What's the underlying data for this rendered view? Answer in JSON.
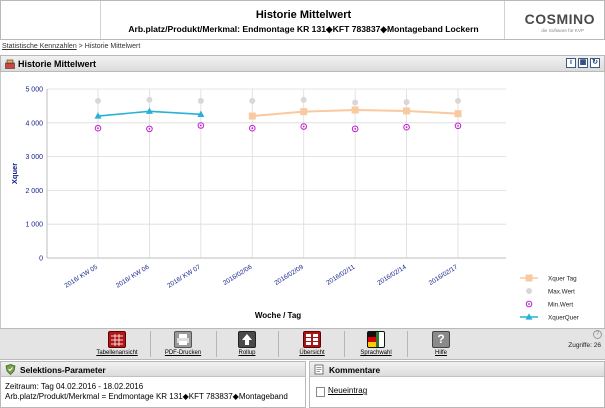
{
  "header": {
    "title": "Historie Mittelwert",
    "subtitle": "Arb.platz/Produkt/Merkmal: Endmontage KR 131◆KFT 783837◆Montageband Lockern",
    "logo_text": "COSMINO",
    "logo_tagline": "die Software für KVP"
  },
  "breadcrumb": {
    "link": "Statistische Kennzahlen",
    "separator": " > ",
    "current": "Historie Mittelwert"
  },
  "panel": {
    "title": "Historie Mittelwert",
    "tools": [
      "i",
      "▦",
      "↻"
    ]
  },
  "colors": {
    "xquer_tag": "#f9c9a0",
    "max_wert": "#d8d8d8",
    "min_wert": "#c21fcf",
    "xquer_quer": "#29b2d6",
    "grid": "#dcdcdc",
    "axis_text": "#0f1c8a"
  },
  "chart_data": {
    "type": "line",
    "ylabel": "Xquer",
    "xlabel": "Woche / Tag",
    "ylim": [
      0,
      5000
    ],
    "yticks": [
      0,
      1000,
      2000,
      3000,
      4000,
      5000
    ],
    "ytick_labels": [
      "0",
      "1 000",
      "2 000",
      "3 000",
      "4 000",
      "5 000"
    ],
    "categories": [
      "2016/ KW 05",
      "2016/ KW 06",
      "2016/ KW 07",
      "2016/02/06",
      "2016/02/09",
      "2016/02/11",
      "2016/02/14",
      "2016/02/17"
    ],
    "grid": true,
    "legend_position": "right",
    "series": [
      {
        "name": "Xquer Tag",
        "marker": "square",
        "values": [
          null,
          null,
          null,
          4200,
          4330,
          4380,
          4350,
          4270
        ]
      },
      {
        "name": "Max.Wert",
        "marker": "circle",
        "values": [
          4650,
          4680,
          4650,
          4650,
          4680,
          4600,
          4610,
          4650
        ]
      },
      {
        "name": "Min.Wert",
        "marker": "ring",
        "values": [
          3840,
          3820,
          3920,
          3840,
          3890,
          3820,
          3870,
          3910
        ]
      },
      {
        "name": "XquerQuer",
        "marker": "triangle",
        "values": [
          4200,
          4340,
          4250,
          null,
          null,
          null,
          null,
          null
        ]
      }
    ]
  },
  "toolbar": {
    "buttons": [
      {
        "label": "Tabellenansicht",
        "icon": "table-icon",
        "color": "#b01818"
      },
      {
        "label": "PDF-Drucken",
        "icon": "printer-icon",
        "color": "#8a8a8a"
      },
      {
        "label": "Rollup",
        "icon": "rollup-arrow-icon",
        "color": "#444444"
      },
      {
        "label": "Übersicht",
        "icon": "overview-grid-icon",
        "color": "#a01818"
      },
      {
        "label": "Sprachwahl",
        "icon": "flag-icon",
        "color": "#2d7a2d"
      },
      {
        "label": "Hilfe",
        "icon": "help-icon",
        "color": "#7a7a7a"
      }
    ],
    "zugriffe": "Zugriffe: 26",
    "help_circle": "?"
  },
  "selection": {
    "title": "Selektions-Parameter",
    "zeitraum": "Zeitraum: Tag 04.02.2016 - 18.02.2016",
    "merkmal": "Arb.platz/Produkt/Merkmal = Endmontage KR 131◆KFT 783837◆Montageband"
  },
  "comments": {
    "title": "Kommentare",
    "new_link": "Neueintrag"
  }
}
